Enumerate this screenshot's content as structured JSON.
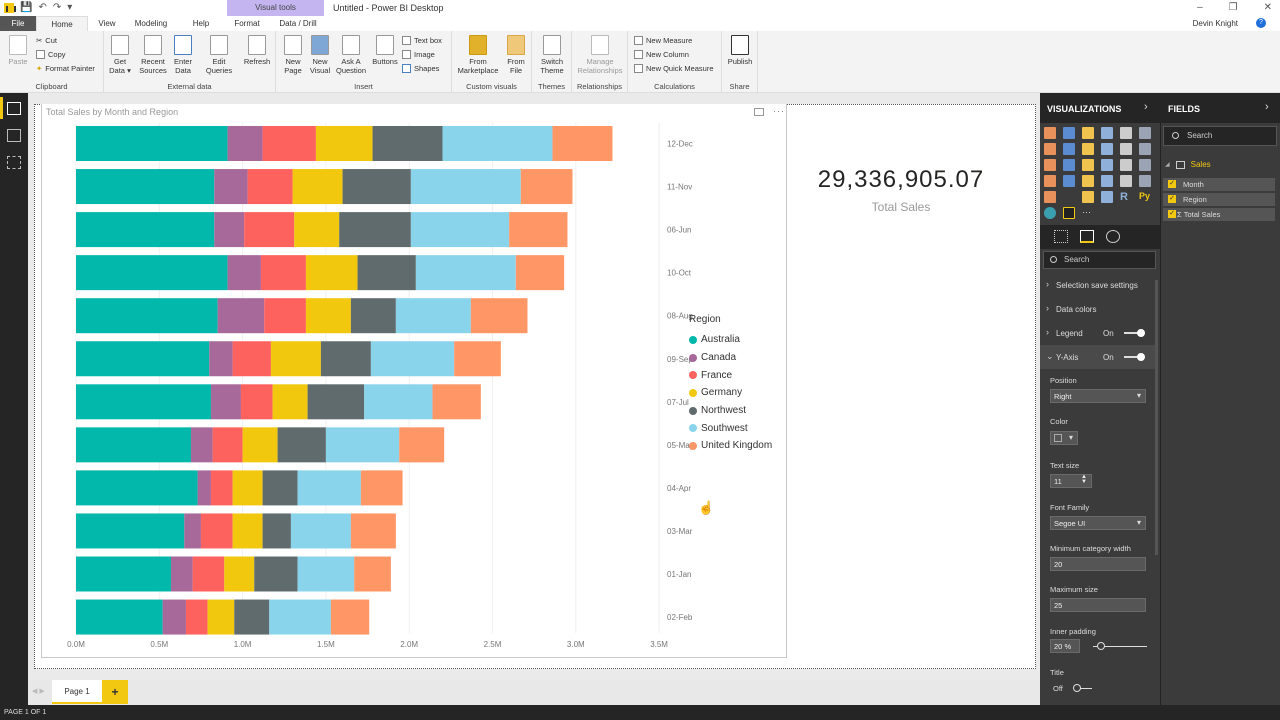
{
  "app": {
    "title": "Untitled - Power BI Desktop",
    "context_tab_group": "Visual tools",
    "user": "Devin Knight",
    "window_controls": [
      "minimize",
      "restore",
      "close"
    ]
  },
  "tabs": [
    {
      "label": "File"
    },
    {
      "label": "Home"
    },
    {
      "label": "View"
    },
    {
      "label": "Modeling"
    },
    {
      "label": "Help"
    },
    {
      "label": "Format"
    },
    {
      "label": "Data / Drill"
    }
  ],
  "ribbon": {
    "groups": [
      {
        "label": "Clipboard",
        "buttons": [
          "Paste"
        ],
        "small": [
          "Cut",
          "Copy",
          "Format Painter"
        ]
      },
      {
        "label": "External data",
        "buttons": [
          "Get Data",
          "Recent Sources",
          "Enter Data",
          "Edit Queries",
          "Refresh"
        ]
      },
      {
        "label": "Insert",
        "buttons": [
          "New Page",
          "New Visual",
          "Ask A Question",
          "Buttons"
        ],
        "small": [
          "Text box",
          "Image",
          "Shapes"
        ]
      },
      {
        "label": "Custom visuals",
        "buttons": [
          "From Marketplace",
          "From File"
        ]
      },
      {
        "label": "Themes",
        "buttons": [
          "Switch Theme"
        ]
      },
      {
        "label": "Relationships",
        "buttons": [
          "Manage Relationships"
        ]
      },
      {
        "label": "Calculations",
        "small": [
          "New Measure",
          "New Column",
          "New Quick Measure"
        ]
      },
      {
        "label": "Share",
        "buttons": [
          "Publish"
        ]
      }
    ]
  },
  "visual": {
    "title": "Total Sales by Month and Region",
    "legend_title": "Region"
  },
  "card": {
    "value": "29,336,905.07",
    "label": "Total Sales"
  },
  "pages": {
    "current": "Page 1",
    "add_label": "+",
    "status": "PAGE 1 OF 1"
  },
  "colors": {
    "Australia": "#01b8aa",
    "Canada": "#a66999",
    "France": "#fd625e",
    "Germany": "#f2c80f",
    "Northwest": "#5f6b6d",
    "Southwest": "#8ad4eb",
    "United Kingdom": "#fe9666",
    "accent": "#f2c811"
  },
  "chart_data": {
    "type": "bar",
    "orientation": "horizontal",
    "stacked": true,
    "title": "Total Sales by Month and Region",
    "xlabel": "",
    "ylabel": "",
    "xlim": [
      0,
      3.5
    ],
    "x_unit": "M",
    "x_ticks": [
      "0.0M",
      "0.5M",
      "1.0M",
      "1.5M",
      "2.0M",
      "2.5M",
      "3.0M",
      "3.5M"
    ],
    "y_axis_position": "right",
    "grid": true,
    "legend": {
      "title": "Region",
      "position": "right"
    },
    "categories": [
      "12-Dec",
      "11-Nov",
      "06-Jun",
      "10-Oct",
      "08-Aug",
      "09-Sep",
      "07-Jul",
      "05-May",
      "04-Apr",
      "03-Mar",
      "01-Jan",
      "02-Feb"
    ],
    "series": [
      {
        "name": "Australia",
        "values": [
          0.91,
          0.83,
          0.83,
          0.91,
          0.85,
          0.8,
          0.81,
          0.69,
          0.73,
          0.65,
          0.57,
          0.52
        ]
      },
      {
        "name": "Canada",
        "values": [
          0.21,
          0.2,
          0.18,
          0.2,
          0.28,
          0.14,
          0.18,
          0.13,
          0.08,
          0.1,
          0.13,
          0.14
        ]
      },
      {
        "name": "France",
        "values": [
          0.32,
          0.27,
          0.3,
          0.27,
          0.25,
          0.23,
          0.19,
          0.18,
          0.13,
          0.19,
          0.19,
          0.13
        ]
      },
      {
        "name": "Germany",
        "values": [
          0.34,
          0.3,
          0.27,
          0.31,
          0.27,
          0.3,
          0.21,
          0.21,
          0.18,
          0.18,
          0.18,
          0.16
        ]
      },
      {
        "name": "Northwest",
        "values": [
          0.42,
          0.41,
          0.43,
          0.35,
          0.27,
          0.3,
          0.34,
          0.29,
          0.21,
          0.17,
          0.26,
          0.21
        ]
      },
      {
        "name": "Southwest",
        "values": [
          0.66,
          0.66,
          0.59,
          0.6,
          0.45,
          0.5,
          0.41,
          0.44,
          0.38,
          0.36,
          0.34,
          0.37
        ]
      },
      {
        "name": "United Kingdom",
        "values": [
          0.36,
          0.31,
          0.35,
          0.29,
          0.34,
          0.28,
          0.29,
          0.27,
          0.25,
          0.27,
          0.22,
          0.23
        ]
      }
    ]
  },
  "viz_pane": {
    "title": "VISUALIZATIONS",
    "search_placeholder": "Search",
    "sections": [
      {
        "label": "Selection save settings",
        "expanded": false
      },
      {
        "label": "Data colors",
        "expanded": false
      },
      {
        "label": "Legend",
        "expanded": false,
        "toggle": "On"
      },
      {
        "label": "Y-Axis",
        "expanded": true,
        "toggle": "On"
      }
    ],
    "yaxis": {
      "position_label": "Position",
      "position_value": "Right",
      "color_label": "Color",
      "text_size_label": "Text size",
      "text_size_value": "11",
      "font_family_label": "Font Family",
      "font_family_value": "Segoe UI",
      "min_cat_width_label": "Minimum category width",
      "min_cat_width_value": "20",
      "max_size_label": "Maximum size",
      "max_size_value": "25",
      "inner_padding_label": "Inner padding",
      "inner_padding_value": "20",
      "inner_padding_unit": "%",
      "title_label": "Title",
      "title_toggle": "Off"
    }
  },
  "fields_pane": {
    "title": "FIELDS",
    "search_placeholder": "Search",
    "table": "Sales",
    "fields": [
      {
        "label": "Month",
        "checked": true
      },
      {
        "label": "Region",
        "checked": true
      },
      {
        "label": "Σ Total Sales",
        "checked": true
      }
    ]
  }
}
